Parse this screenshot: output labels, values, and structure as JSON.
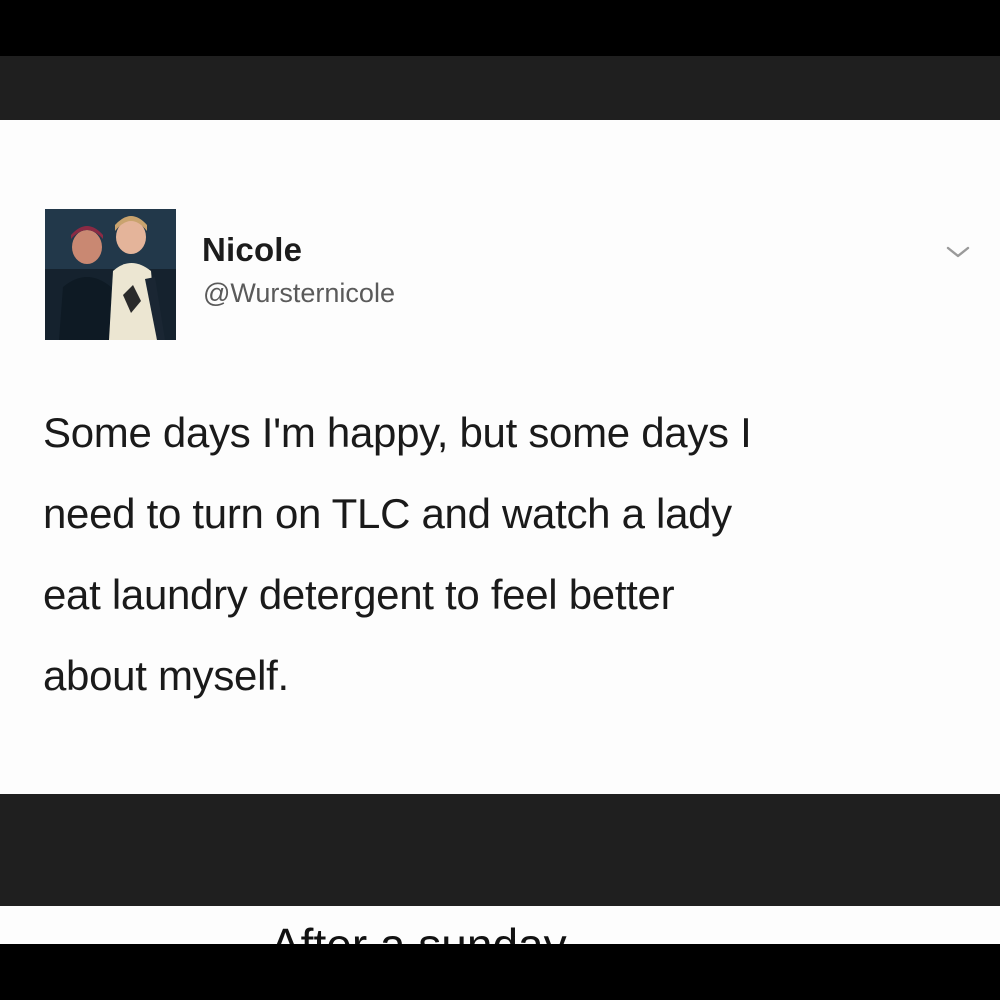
{
  "tweet": {
    "display_name": "Nicole",
    "handle": "@Wursternicole",
    "avatar_icon": "profile-photo",
    "menu_icon": "chevron-down-icon",
    "text_lines": [
      "Some days I'm happy, but some days I",
      "need to turn on TLC and watch a lady",
      "eat laundry detergent to feel better",
      "about myself."
    ]
  },
  "next_post": {
    "caption_partial": "After a sunday..."
  },
  "colors": {
    "outer_frame": "#000000",
    "dark_band": "#1f1f1f",
    "card_background": "#fdfdfd",
    "primary_text": "#1a1a1a",
    "secondary_text": "#5a5a5a"
  }
}
